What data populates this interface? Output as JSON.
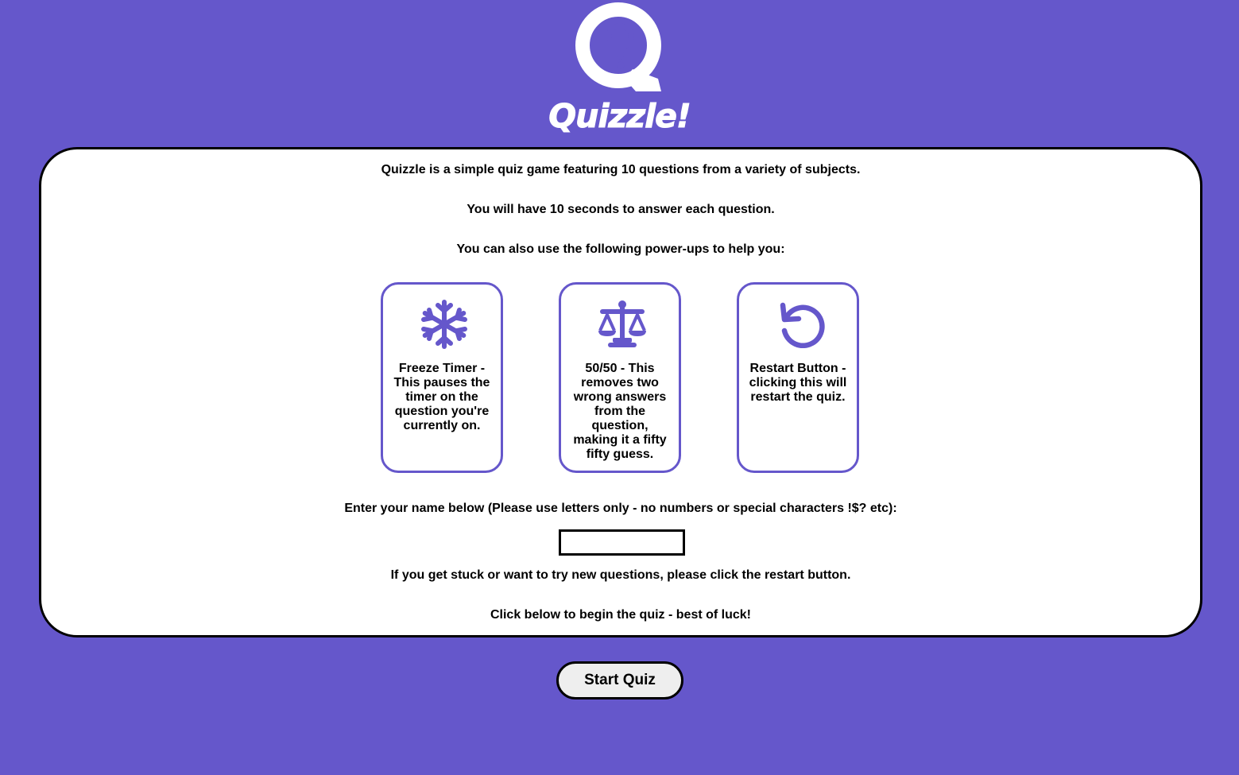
{
  "logo": {
    "icon": "question-mark-q-icon",
    "title": "Quizzle!"
  },
  "intro": {
    "line1": "Quizzle is a simple quiz game featuring 10 questions from a variety of subjects.",
    "line2": "You will have 10 seconds to answer each question.",
    "line3": "You can also use the following power-ups to help you:"
  },
  "powerups": [
    {
      "icon": "snowflake-icon",
      "text": "Freeze Timer - This pauses the timer on the question you're currently on."
    },
    {
      "icon": "scales-icon",
      "text": "50/50 - This removes two wrong answers from the question, making it a fifty fifty guess."
    },
    {
      "icon": "restart-icon",
      "text": "Restart Button - clicking this will restart the quiz."
    }
  ],
  "name_prompt": "Enter your name below (Please use letters only - no numbers or special characters !$? etc):",
  "name_input": {
    "value": "",
    "placeholder": ""
  },
  "stuck_text": "If you get stuck or want to try new questions, please click the restart button.",
  "begin_text": "Click below to begin the quiz - best of luck!",
  "start_button": "Start Quiz",
  "colors": {
    "background": "#6557cb",
    "accent": "#6557cb",
    "card": "#ffffff"
  }
}
